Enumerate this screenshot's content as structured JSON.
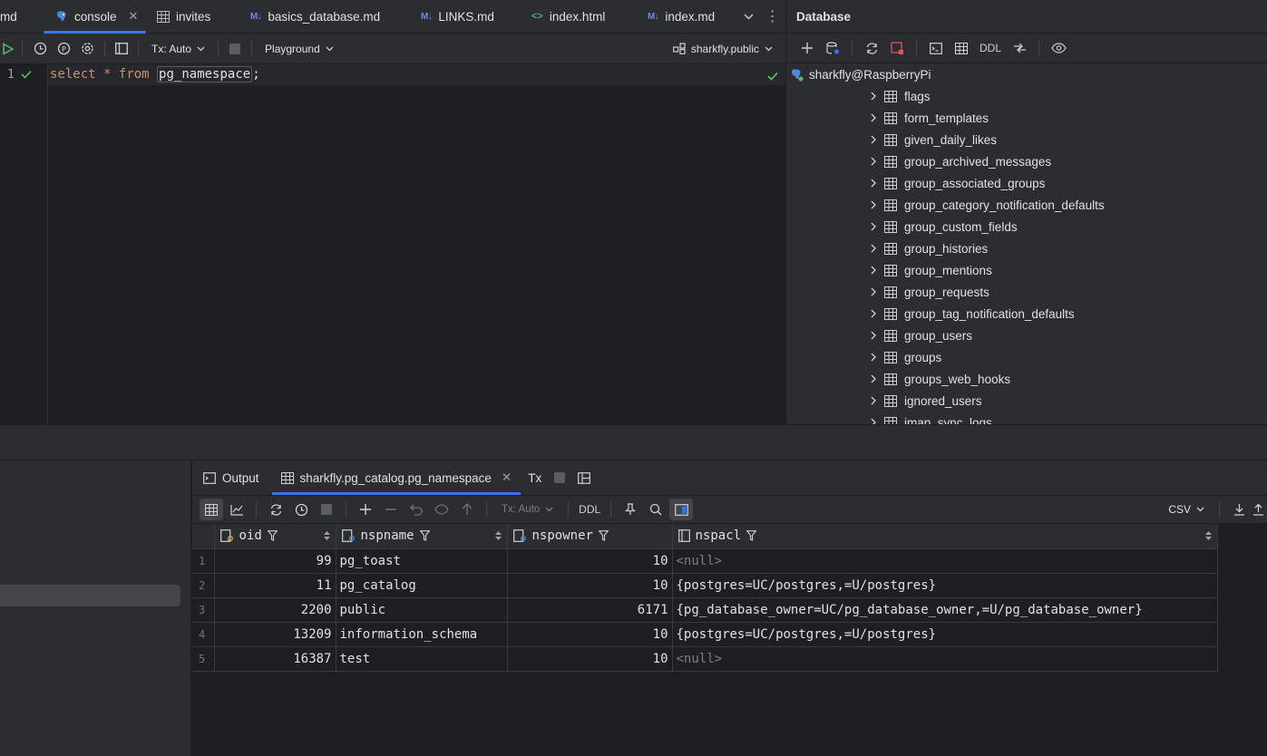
{
  "editor_tabs": [
    {
      "label": "md",
      "icon": "none"
    },
    {
      "label": "console",
      "icon": "postgres-icon",
      "active": true
    },
    {
      "label": "invites",
      "icon": "table-icon"
    },
    {
      "label": "basics_database.md",
      "icon": "markdown-icon"
    },
    {
      "label": "LINKS.md",
      "icon": "markdown-icon"
    },
    {
      "label": "index.html",
      "icon": "html-icon"
    },
    {
      "label": "index.md",
      "icon": "markdown-icon"
    }
  ],
  "console_toolbar": {
    "tx_mode": "Tx: Auto",
    "playground": "Playground",
    "schema": "sharkfly.public"
  },
  "editor": {
    "line_number": "1",
    "code": {
      "kw1": "select",
      "star": "*",
      "kw2": "from",
      "table": "pg_namespace",
      "end": ";"
    }
  },
  "database_panel": {
    "title": "Database",
    "ddl_label": "DDL",
    "root": "sharkfly@RaspberryPi",
    "tables": [
      "flags",
      "form_templates",
      "given_daily_likes",
      "group_archived_messages",
      "group_associated_groups",
      "group_category_notification_defaults",
      "group_custom_fields",
      "group_histories",
      "group_mentions",
      "group_requests",
      "group_tag_notification_defaults",
      "group_users",
      "groups",
      "groups_web_hooks",
      "ignored_users",
      "imap_sync_logs"
    ]
  },
  "results": {
    "tabs": {
      "output": "Output",
      "result": "sharkfly.pg_catalog.pg_namespace",
      "tx": "Tx"
    },
    "toolbar": {
      "tx_mode": "Tx: Auto",
      "ddl": "DDL",
      "export_format": "CSV"
    },
    "columns": [
      "oid",
      "nspname",
      "nspowner",
      "nspacl"
    ],
    "rows": [
      {
        "n": "1",
        "oid": "99",
        "nspname": "pg_toast",
        "nspowner": "10",
        "nspacl": "<null>"
      },
      {
        "n": "2",
        "oid": "11",
        "nspname": "pg_catalog",
        "nspowner": "10",
        "nspacl": "{postgres=UC/postgres,=U/postgres}"
      },
      {
        "n": "3",
        "oid": "2200",
        "nspname": "public",
        "nspowner": "6171",
        "nspacl": "{pg_database_owner=UC/pg_database_owner,=U/pg_database_owner}"
      },
      {
        "n": "4",
        "oid": "13209",
        "nspname": "information_schema",
        "nspowner": "10",
        "nspacl": "{postgres=UC/postgres,=U/postgres}"
      },
      {
        "n": "5",
        "oid": "16387",
        "nspname": "test",
        "nspowner": "10",
        "nspacl": "<null>"
      }
    ]
  },
  "colors": {
    "accent": "#3574f0",
    "keyword": "#cf8e6d",
    "success": "#5fb865"
  }
}
